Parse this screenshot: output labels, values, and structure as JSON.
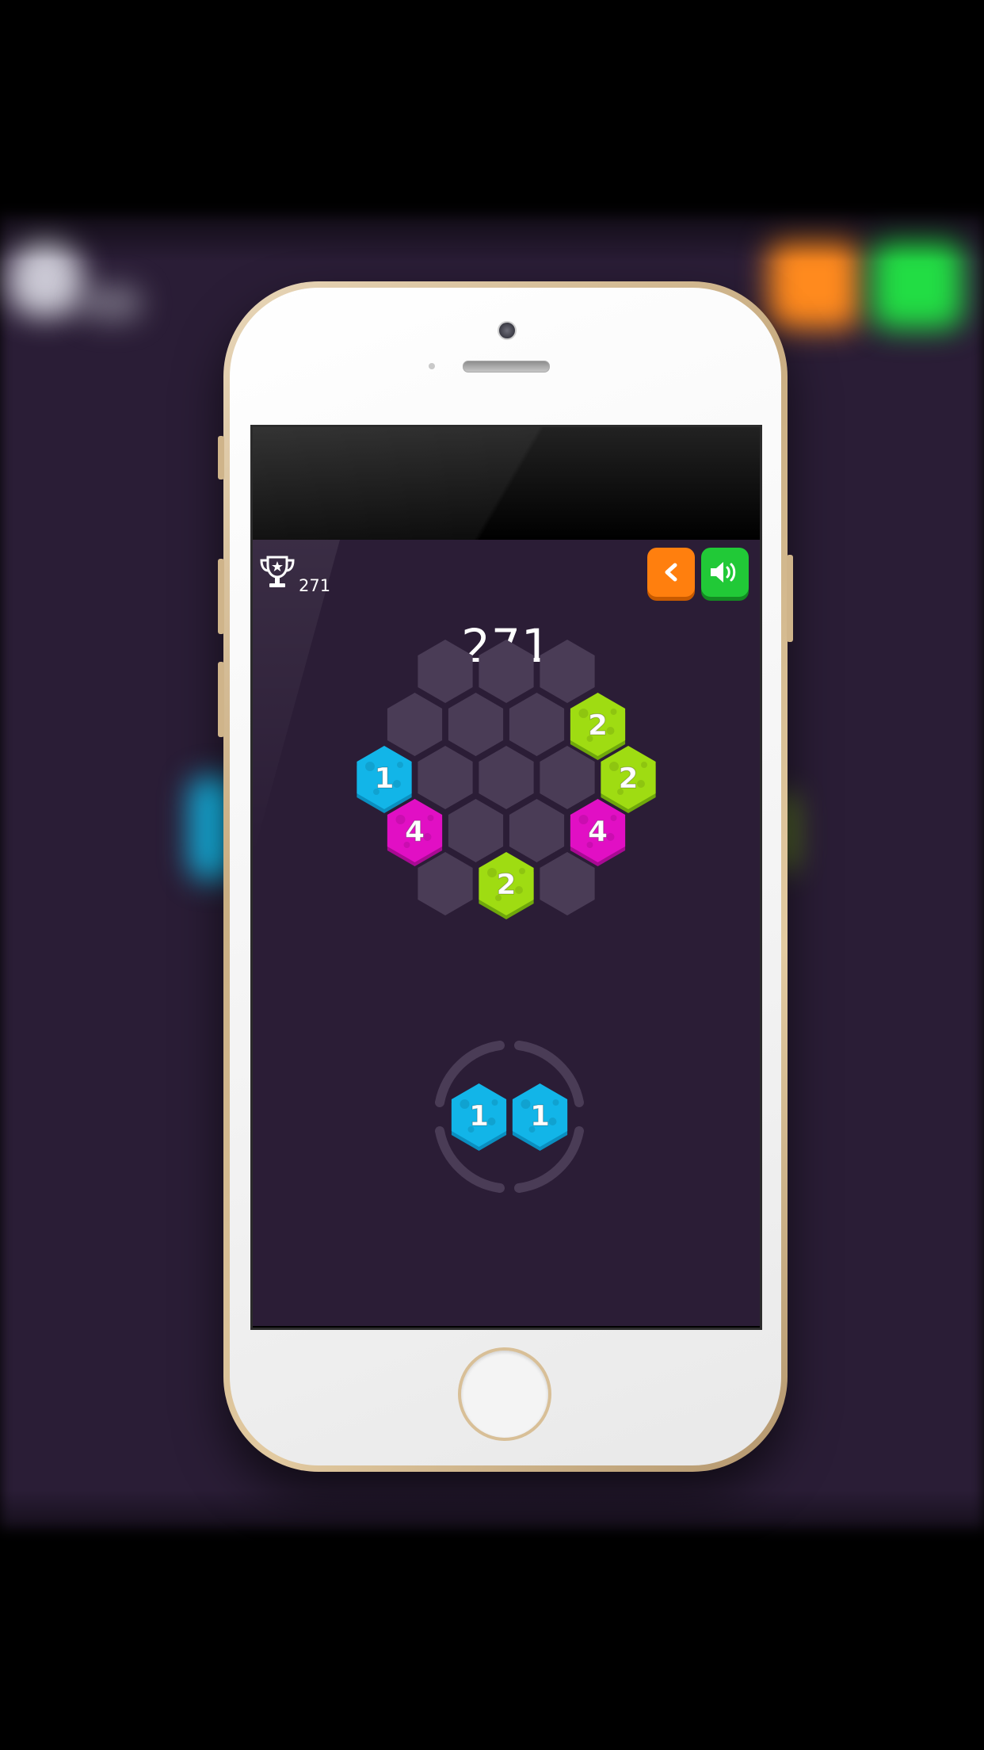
{
  "header": {
    "best_score": "271",
    "current_score": "271"
  },
  "buttons": {
    "back_icon": "chevron-left-icon",
    "sound_icon": "speaker-icon"
  },
  "colors": {
    "orange": "#ff7f0e",
    "green": "#21c937",
    "cyan": "#12b5e8",
    "lime": "#9fdc12",
    "magenta": "#e10fc4",
    "empty_cell": "#4a3c56",
    "background": "#2b1d36"
  },
  "board": {
    "cells": [
      {
        "row": 0,
        "col": 0,
        "value": ""
      },
      {
        "row": 0,
        "col": 1,
        "value": ""
      },
      {
        "row": 0,
        "col": 2,
        "value": ""
      },
      {
        "row": 1,
        "col": 0,
        "value": ""
      },
      {
        "row": 1,
        "col": 1,
        "value": ""
      },
      {
        "row": 1,
        "col": 2,
        "value": ""
      },
      {
        "row": 1,
        "col": 3,
        "value": "2",
        "color": "lime"
      },
      {
        "row": 2,
        "col": 0,
        "value": "1",
        "color": "cyan"
      },
      {
        "row": 2,
        "col": 1,
        "value": ""
      },
      {
        "row": 2,
        "col": 2,
        "value": ""
      },
      {
        "row": 2,
        "col": 3,
        "value": ""
      },
      {
        "row": 2,
        "col": 4,
        "value": "2",
        "color": "lime"
      },
      {
        "row": 3,
        "col": 0,
        "value": "4",
        "color": "magenta"
      },
      {
        "row": 3,
        "col": 1,
        "value": ""
      },
      {
        "row": 3,
        "col": 2,
        "value": ""
      },
      {
        "row": 3,
        "col": 3,
        "value": "4",
        "color": "magenta"
      },
      {
        "row": 4,
        "col": 0,
        "value": ""
      },
      {
        "row": 4,
        "col": 1,
        "value": "2",
        "color": "lime"
      },
      {
        "row": 4,
        "col": 2,
        "value": ""
      }
    ]
  },
  "next_piece": {
    "tiles": [
      {
        "value": "1",
        "color": "cyan"
      },
      {
        "value": "1",
        "color": "cyan"
      }
    ]
  }
}
